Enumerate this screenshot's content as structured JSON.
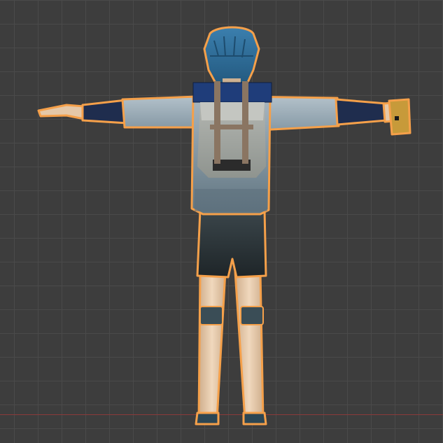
{
  "viewport": {
    "background_color": "#3d3d3d",
    "grid_color": "#4a4a4a",
    "x_axis_color": "#8a3a3a",
    "selection_outline_color": "#f5a04a"
  },
  "model": {
    "selected": true,
    "pose": "T-pose",
    "view": "back",
    "colors": {
      "hair": "#2f6f9c",
      "skin": "#e5c8a8",
      "shirt": "#9aaab6",
      "shirt_shadow": "#6f8490",
      "sleeve_cuff": "#1f2d4e",
      "backpack_body": "#a8aba6",
      "backpack_strap_top": "#1f3d7a",
      "backpack_straps": "#8a7562",
      "shorts": "#2b3438",
      "knee_pad": "#3a4d56",
      "shoes": "#2c4654",
      "held_item": "#c79a3a"
    }
  }
}
